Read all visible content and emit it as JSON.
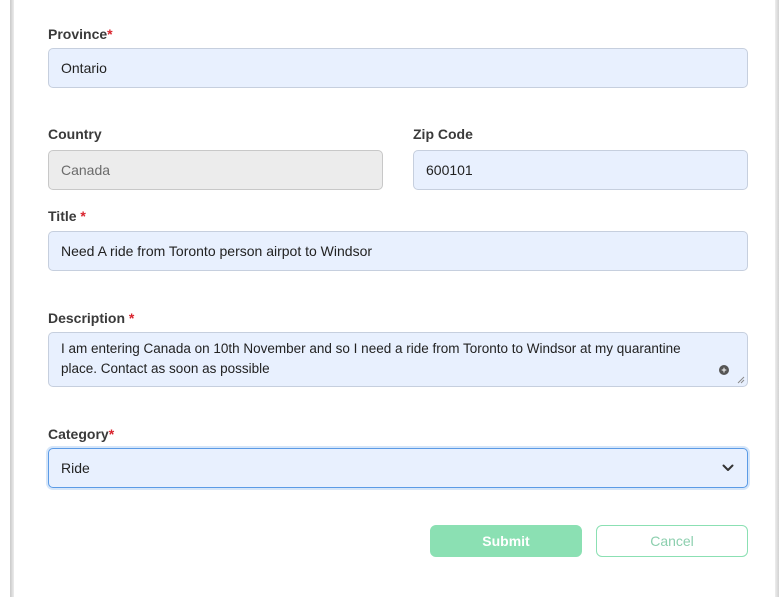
{
  "form": {
    "province": {
      "label": "Province",
      "required_mark": "*",
      "value": "Ontario"
    },
    "country": {
      "label": "Country",
      "value": "Canada"
    },
    "zip": {
      "label": "Zip Code",
      "value": "600101"
    },
    "title": {
      "label": "Title",
      "required_mark": "*",
      "value": "Need A ride from Toronto person airpot to Windsor"
    },
    "description": {
      "label": "Description",
      "required_mark": "*",
      "value": "I am entering Canada on 10th November and so I need a ride from Toronto to Windsor at my quarantine place. Contact as soon as possible"
    },
    "category": {
      "label": "Category",
      "required_mark": "*",
      "selected": "Ride"
    }
  },
  "actions": {
    "submit_label": "Submit",
    "cancel_label": "Cancel"
  },
  "colors": {
    "required": "#d9232d",
    "field_bg": "#e8f0fe",
    "disabled_bg": "#ececec",
    "button_accent": "#8be0b3"
  },
  "icons": {
    "select_arrow": "chevron-down-icon",
    "textarea_expand": "plus-circle-icon",
    "textarea_resize": "resize-handle-icon"
  }
}
